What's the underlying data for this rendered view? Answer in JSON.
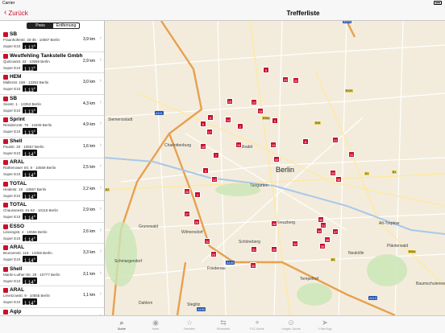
{
  "status": {
    "carrier": "Carrier",
    "time": ""
  },
  "nav": {
    "back_label": "Zurück",
    "title": "Trefferliste"
  },
  "segment": {
    "options": [
      "Preis",
      "Entfernung"
    ],
    "selected": "Preis"
  },
  "stations": [
    {
      "name": "SB",
      "address": "Fraunhoferstr. 33-36 · 10587 Berlin",
      "fuel": "Super E10",
      "price": "1,12",
      "price_sup": "9",
      "distance": "3,9 km"
    },
    {
      "name": "Westfehling Tankstelle Gmbh",
      "address": "Quitzowstr. 33 · 10559 Berlin",
      "fuel": "Super E10",
      "price": "1,12",
      "price_sup": "9",
      "distance": "2,9 km"
    },
    {
      "name": "HEM",
      "address": "Müllerstr. 168 · 13353 Berlin",
      "fuel": "Super E10",
      "price": "1,13",
      "price_sup": "9",
      "distance": "3,0 km"
    },
    {
      "name": "SB",
      "address": "Seestr. 1 · 13353 Berlin",
      "fuel": "Super E10",
      "price": "1,13",
      "price_sup": "9",
      "distance": "4,3 km"
    },
    {
      "name": "Sprint",
      "address": "Residenzstr. 79 · 13409 Berlin",
      "fuel": "Super E10",
      "price": "1,13",
      "price_sup": "9",
      "distance": "4,9 km"
    },
    {
      "name": "Shell",
      "address": "Paulstr. 20 · 10557 Berlin",
      "fuel": "Super E10",
      "price": "1,14",
      "price_sup": "9",
      "distance": "1,6 km"
    },
    {
      "name": "ARAL",
      "address": "Rathenower Str. 8 · 10559 Berlin",
      "fuel": "Super E10",
      "price": "1,14",
      "price_sup": "9",
      "distance": "2,5 km"
    },
    {
      "name": "TOTAL",
      "address": "Heidestr. 19 · 10557 Berlin",
      "fuel": "Super E10",
      "price": "1,14",
      "price_sup": "9",
      "distance": "2,2 km"
    },
    {
      "name": "TOTAL",
      "address": "Chausseestr. 61-62 · 10115 Berlin",
      "fuel": "Super E10",
      "price": "1,14",
      "price_sup": "9",
      "distance": "2,9 km"
    },
    {
      "name": "ESSO",
      "address": "Lessingstr. 4 · 10555 Berlin",
      "fuel": "Super E10",
      "price": "1,14",
      "price_sup": "9",
      "distance": "2,6 km"
    },
    {
      "name": "ARAL",
      "address": "Brunnenstr. 119 · 13355 Berlin",
      "fuel": "Super E10",
      "price": "1,14",
      "price_sup": "9",
      "distance": "3,3 km"
    },
    {
      "name": "Shell",
      "address": "Martin-Luther-Str. 29 · 10777 Berlin",
      "fuel": "Super E10",
      "price": "1,14",
      "price_sup": "9",
      "distance": "3,1 km"
    },
    {
      "name": "ARAL",
      "address": "Levetzowstr. 9 · 10555 Berlin",
      "fuel": "Super E10",
      "price": "1,14",
      "price_sup": "9",
      "distance": "1,1 km"
    },
    {
      "name": "Agip",
      "address": "",
      "fuel": "",
      "price": "",
      "price_sup": "",
      "distance": ""
    }
  ],
  "map": {
    "places": [
      "Siemensstadt",
      "Charlottenburg",
      "Moabit",
      "Tiergarten",
      "Berlin",
      "Kreuzberg",
      "Schöneberg",
      "Wilmersdorf",
      "Grunewald",
      "Schmargendorf",
      "Friedenau",
      "Tempelhof",
      "Steglitz",
      "Dahlem",
      "Neukölln",
      "Alt-Treptow",
      "Plänterwald",
      "Baumschulenweg"
    ],
    "highways": [
      "A111",
      "A100",
      "A100",
      "A113",
      "A114"
    ],
    "roads": [
      "B96a",
      "B109",
      "B96",
      "B1",
      "B2",
      "B1",
      "B96a",
      "B5"
    ],
    "markers": [
      "5",
      "23",
      "22",
      "19",
      "13",
      "15",
      "14",
      "4",
      "17",
      "6",
      "2",
      "16",
      "10",
      "9",
      "3",
      "7",
      "41",
      "11",
      "18",
      "12",
      "40",
      "8",
      "1",
      "33",
      "38",
      "26",
      "27",
      "25",
      "35",
      "34",
      "39",
      "21",
      "37",
      "28",
      "20",
      "32",
      "36",
      "24",
      "29",
      "31",
      "30"
    ]
  },
  "tabs": [
    {
      "label": "Suche",
      "icon": "search-icon",
      "active": true
    },
    {
      "label": "Karte",
      "icon": "map-icon",
      "active": false
    },
    {
      "label": "Favoriten",
      "icon": "star-icon",
      "active": false
    },
    {
      "label": "Rückwärts",
      "icon": "reverse-icon",
      "active": false
    },
    {
      "label": "PLZ-Suche",
      "icon": "zip-search-icon",
      "active": false
    },
    {
      "label": "Umgeb.-Suche",
      "icon": "nearby-search-icon",
      "active": false
    },
    {
      "label": "Y-Navi App",
      "icon": "navi-icon",
      "active": false
    }
  ]
}
